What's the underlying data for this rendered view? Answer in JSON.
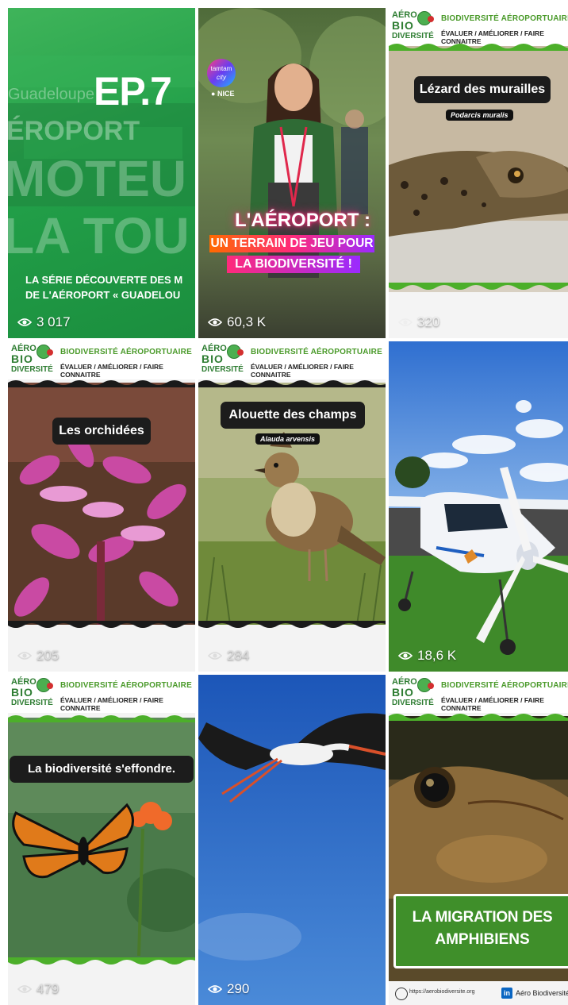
{
  "tiles": [
    {
      "id": "ep7",
      "views": "3 017",
      "ep_label": "EP.7",
      "bg_text_1": "Guadeloupe",
      "bg_text_2": "ÉROPORT",
      "bg_text_3": "MOTEU",
      "bg_text_4": "LA TOU",
      "subtitle_1": "LA SÉRIE DÉCOUVERTE DES M",
      "subtitle_2": "DE L'AÉROPORT « GUADELOU"
    },
    {
      "id": "nice",
      "views": "60,3 K",
      "badge_name": "tamtam",
      "badge_sub": "city",
      "location": "NICE",
      "headline_1": "L'AÉROPORT :",
      "headline_2": "UN TERRAIN DE JEU POUR",
      "headline_3": "LA BIODIVERSITÉ !"
    },
    {
      "id": "lezard",
      "views": "320",
      "label": "Lézard des murailles",
      "latin": "Podarcis muralis"
    },
    {
      "id": "orchidees",
      "views": "205",
      "label": "Les orchidées"
    },
    {
      "id": "alouette",
      "views": "284",
      "label": "Alouette des champs",
      "latin": "Alauda arvensis"
    },
    {
      "id": "avion",
      "views": "18,6 K"
    },
    {
      "id": "biodiv",
      "views": "479",
      "label": "La biodiversité s'effondre."
    },
    {
      "id": "cigogne",
      "views": "290"
    },
    {
      "id": "amphibiens",
      "label_1": "LA MIGRATION DES",
      "label_2": "AMPHIBIENS",
      "footer_left": "https://aerobiodiversite.org",
      "footer_right": "Aéro Biodiversité"
    }
  ],
  "bio_header": {
    "logo_1": "AÉRO",
    "logo_2": "BIO",
    "logo_3": "DIVERSITÉ",
    "title": "BIODIVERSITÉ AÉROPORTUAIRE",
    "subtitle": "ÉVALUER / AMÉLIORER / FAIRE CONNAITRE"
  },
  "colors": {
    "brand_green": "#4a9a2a",
    "dark_pill": "#1c1c1c",
    "accent_pink": "#e6286e"
  },
  "icons": {
    "views": "eye-icon"
  }
}
